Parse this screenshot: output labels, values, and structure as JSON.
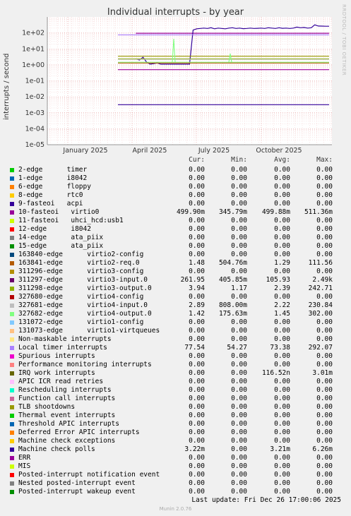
{
  "title": "Individual interrupts - by year",
  "side_text": "RRDTOOL / TOBI OETIKER",
  "ylabel": "interrupts / second",
  "headers": {
    "cur": "Cur:",
    "min": "Min:",
    "avg": "Avg:",
    "max": "Max:"
  },
  "last_update": "Last update: Fri Dec 26 17:00:06 2025",
  "footer": "Munin 2.0.76",
  "chart_data": {
    "type": "line",
    "title": "Individual interrupts - by year",
    "ylabel": "interrupts / second",
    "yscale": "log",
    "ylim": [
      1e-05,
      1000
    ],
    "yticks": [
      "1e+02",
      "1e+01",
      "1e+00",
      "1e-01",
      "1e-02",
      "1e-03",
      "1e-04",
      "1e-05"
    ],
    "xticks": [
      "January 2025",
      "April 2025",
      "July 2025",
      "October 2025"
    ],
    "grid": true,
    "series": [
      {
        "name": "10-fasteoi virtio0",
        "color": "#990099",
        "values": [
          0,
          0,
          0,
          0,
          0,
          95,
          95,
          95,
          95,
          95,
          95,
          95,
          95,
          95,
          95,
          95,
          95,
          95,
          95,
          95,
          95,
          95,
          95,
          95,
          95,
          95,
          95,
          95,
          95,
          95,
          95,
          95,
          95,
          95,
          95,
          95,
          95,
          95,
          95,
          95,
          95,
          95,
          95,
          95,
          95,
          95,
          95,
          95,
          95,
          95,
          95,
          95,
          95,
          95,
          95,
          95,
          95,
          95,
          95,
          95
        ]
      },
      {
        "name": "327680-edge virtio4-config",
        "color": "#330099",
        "values": [
          0,
          0,
          0,
          0,
          0,
          2.4,
          2,
          3,
          1.5,
          1.1,
          1.2,
          1.3,
          1.1,
          1.1,
          1.1,
          1.1,
          1.1,
          1.1,
          1.1,
          1.1,
          1.1,
          150,
          180,
          190,
          200,
          190,
          210,
          180,
          200,
          190,
          180,
          200,
          210,
          190,
          200,
          185,
          190,
          200,
          190,
          195,
          200,
          190,
          210,
          200,
          190,
          210,
          195,
          200,
          190,
          200,
          230,
          210,
          220,
          200,
          210,
          320,
          270,
          265,
          262,
          261
        ]
      }
    ]
  },
  "rows": [
    {
      "color": "#00cc00",
      "label": "2-edge      timer",
      "cur": "0.00",
      "min": "0.00",
      "avg": "0.00",
      "max": "0.00"
    },
    {
      "color": "#0066b3",
      "label": "1-edge      i8042",
      "cur": "0.00",
      "min": "0.00",
      "avg": "0.00",
      "max": "0.00"
    },
    {
      "color": "#ff8000",
      "label": "6-edge      floppy",
      "cur": "0.00",
      "min": "0.00",
      "avg": "0.00",
      "max": "0.00"
    },
    {
      "color": "#ffcc00",
      "label": "8-edge      rtc0",
      "cur": "0.00",
      "min": "0.00",
      "avg": "0.00",
      "max": "0.00"
    },
    {
      "color": "#330099",
      "label": "9-fasteoi   acpi",
      "cur": "0.00",
      "min": "0.00",
      "avg": "0.00",
      "max": "0.00"
    },
    {
      "color": "#990099",
      "label": "10-fasteoi   virtio0",
      "cur": "499.90m",
      "min": "345.79m",
      "avg": "499.88m",
      "max": "511.36m"
    },
    {
      "color": "#ccff00",
      "label": "11-fasteoi   uhci_hcd:usb1",
      "cur": "0.00",
      "min": "0.00",
      "avg": "0.00",
      "max": "0.00"
    },
    {
      "color": "#ff0000",
      "label": "12-edge      i8042",
      "cur": "0.00",
      "min": "0.00",
      "avg": "0.00",
      "max": "0.00"
    },
    {
      "color": "#808080",
      "label": "14-edge      ata_piix",
      "cur": "0.00",
      "min": "0.00",
      "avg": "0.00",
      "max": "0.00"
    },
    {
      "color": "#008f00",
      "label": "15-edge      ata_piix",
      "cur": "0.00",
      "min": "0.00",
      "avg": "0.00",
      "max": "0.00"
    },
    {
      "color": "#00487d",
      "label": "163840-edge      virtio2-config",
      "cur": "0.00",
      "min": "0.00",
      "avg": "0.00",
      "max": "0.00"
    },
    {
      "color": "#b35a00",
      "label": "163841-edge      virtio2-req.0",
      "cur": "1.48",
      "min": "504.76m",
      "avg": "1.29",
      "max": "111.56"
    },
    {
      "color": "#b38f00",
      "label": "311296-edge      virtio3-config",
      "cur": "0.00",
      "min": "0.00",
      "avg": "0.00",
      "max": "0.00"
    },
    {
      "color": "#6b006b",
      "label": "311297-edge      virtio3-input.0",
      "cur": "261.95",
      "min": "405.85m",
      "avg": "105.93",
      "max": "2.49k"
    },
    {
      "color": "#8fb300",
      "label": "311298-edge      virtio3-output.0",
      "cur": "3.94",
      "min": "1.17",
      "avg": "2.39",
      "max": "242.71"
    },
    {
      "color": "#b30000",
      "label": "327680-edge      virtio4-config",
      "cur": "0.00",
      "min": "0.00",
      "avg": "0.00",
      "max": "0.00"
    },
    {
      "color": "#bebebe",
      "label": "327681-edge      virtio4-input.0",
      "cur": "2.89",
      "min": "808.00m",
      "avg": "2.22",
      "max": "230.84"
    },
    {
      "color": "#80ff80",
      "label": "327682-edge      virtio4-output.0",
      "cur": "1.42",
      "min": "175.63m",
      "avg": "1.45",
      "max": "302.00"
    },
    {
      "color": "#80c9ff",
      "label": "131072-edge      virtio1-config",
      "cur": "0.00",
      "min": "0.00",
      "avg": "0.00",
      "max": "0.00"
    },
    {
      "color": "#ffc080",
      "label": "131073-edge      virtio1-virtqueues",
      "cur": "0.00",
      "min": "0.00",
      "avg": "0.00",
      "max": "0.00"
    },
    {
      "color": "#ffe680",
      "label": "Non-maskable interrupts",
      "cur": "0.00",
      "min": "0.00",
      "avg": "0.00",
      "max": "0.00"
    },
    {
      "color": "#aa80ff",
      "label": "Local timer interrupts",
      "cur": "77.54",
      "min": "54.27",
      "avg": "73.38",
      "max": "292.07"
    },
    {
      "color": "#ee00cc",
      "label": "Spurious interrupts",
      "cur": "0.00",
      "min": "0.00",
      "avg": "0.00",
      "max": "0.00"
    },
    {
      "color": "#ff8080",
      "label": "Performance monitoring interrupts",
      "cur": "0.00",
      "min": "0.00",
      "avg": "0.00",
      "max": "0.00"
    },
    {
      "color": "#666600",
      "label": "IRQ work interrupts",
      "cur": "0.00",
      "min": "0.00",
      "avg": "116.52n",
      "max": "3.01m"
    },
    {
      "color": "#ffbfff",
      "label": "APIC ICR read retries",
      "cur": "0.00",
      "min": "0.00",
      "avg": "0.00",
      "max": "0.00"
    },
    {
      "color": "#00ffcc",
      "label": "Rescheduling interrupts",
      "cur": "0.00",
      "min": "0.00",
      "avg": "0.00",
      "max": "0.00"
    },
    {
      "color": "#cc6699",
      "label": "Function call interrupts",
      "cur": "0.00",
      "min": "0.00",
      "avg": "0.00",
      "max": "0.00"
    },
    {
      "color": "#999900",
      "label": "TLB shootdowns",
      "cur": "0.00",
      "min": "0.00",
      "avg": "0.00",
      "max": "0.00"
    },
    {
      "color": "#00cc00",
      "label": "Thermal event interrupts",
      "cur": "0.00",
      "min": "0.00",
      "avg": "0.00",
      "max": "0.00"
    },
    {
      "color": "#0066b3",
      "label": "Threshold APIC interrupts",
      "cur": "0.00",
      "min": "0.00",
      "avg": "0.00",
      "max": "0.00"
    },
    {
      "color": "#ff8000",
      "label": "Deferred Error APIC interrupts",
      "cur": "0.00",
      "min": "0.00",
      "avg": "0.00",
      "max": "0.00"
    },
    {
      "color": "#ffcc00",
      "label": "Machine check exceptions",
      "cur": "0.00",
      "min": "0.00",
      "avg": "0.00",
      "max": "0.00"
    },
    {
      "color": "#330099",
      "label": "Machine check polls",
      "cur": "3.22m",
      "min": "0.00",
      "avg": "3.21m",
      "max": "6.26m"
    },
    {
      "color": "#990099",
      "label": "ERR",
      "cur": "0.00",
      "min": "0.00",
      "avg": "0.00",
      "max": "0.00"
    },
    {
      "color": "#ccff00",
      "label": "MIS",
      "cur": "0.00",
      "min": "0.00",
      "avg": "0.00",
      "max": "0.00"
    },
    {
      "color": "#ff0000",
      "label": "Posted-interrupt notification event",
      "cur": "0.00",
      "min": "0.00",
      "avg": "0.00",
      "max": "0.00"
    },
    {
      "color": "#808080",
      "label": "Nested posted-interrupt event",
      "cur": "0.00",
      "min": "0.00",
      "avg": "0.00",
      "max": "0.00"
    },
    {
      "color": "#008f00",
      "label": "Posted-interrupt wakeup event",
      "cur": "0.00",
      "min": "0.00",
      "avg": "0.00",
      "max": "0.00"
    }
  ]
}
